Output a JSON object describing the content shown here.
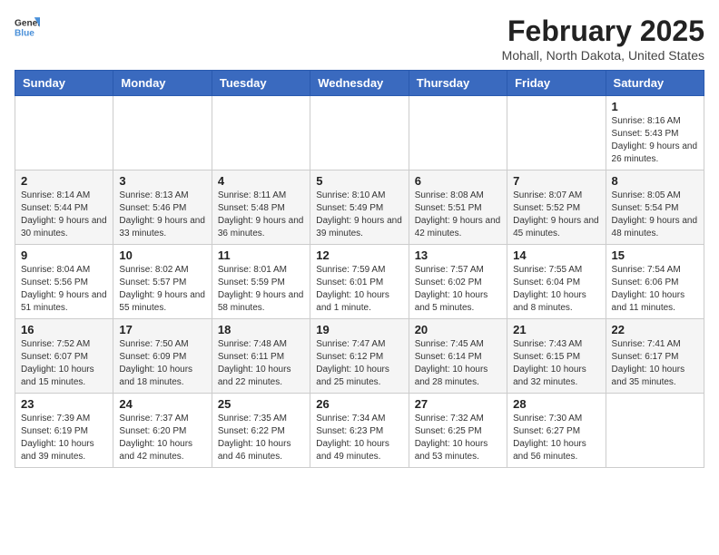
{
  "header": {
    "logo_general": "General",
    "logo_blue": "Blue",
    "title": "February 2025",
    "subtitle": "Mohall, North Dakota, United States"
  },
  "calendar": {
    "days_of_week": [
      "Sunday",
      "Monday",
      "Tuesday",
      "Wednesday",
      "Thursday",
      "Friday",
      "Saturday"
    ],
    "weeks": [
      [
        {
          "day": "",
          "info": ""
        },
        {
          "day": "",
          "info": ""
        },
        {
          "day": "",
          "info": ""
        },
        {
          "day": "",
          "info": ""
        },
        {
          "day": "",
          "info": ""
        },
        {
          "day": "",
          "info": ""
        },
        {
          "day": "1",
          "info": "Sunrise: 8:16 AM\nSunset: 5:43 PM\nDaylight: 9 hours and 26 minutes."
        }
      ],
      [
        {
          "day": "2",
          "info": "Sunrise: 8:14 AM\nSunset: 5:44 PM\nDaylight: 9 hours and 30 minutes."
        },
        {
          "day": "3",
          "info": "Sunrise: 8:13 AM\nSunset: 5:46 PM\nDaylight: 9 hours and 33 minutes."
        },
        {
          "day": "4",
          "info": "Sunrise: 8:11 AM\nSunset: 5:48 PM\nDaylight: 9 hours and 36 minutes."
        },
        {
          "day": "5",
          "info": "Sunrise: 8:10 AM\nSunset: 5:49 PM\nDaylight: 9 hours and 39 minutes."
        },
        {
          "day": "6",
          "info": "Sunrise: 8:08 AM\nSunset: 5:51 PM\nDaylight: 9 hours and 42 minutes."
        },
        {
          "day": "7",
          "info": "Sunrise: 8:07 AM\nSunset: 5:52 PM\nDaylight: 9 hours and 45 minutes."
        },
        {
          "day": "8",
          "info": "Sunrise: 8:05 AM\nSunset: 5:54 PM\nDaylight: 9 hours and 48 minutes."
        }
      ],
      [
        {
          "day": "9",
          "info": "Sunrise: 8:04 AM\nSunset: 5:56 PM\nDaylight: 9 hours and 51 minutes."
        },
        {
          "day": "10",
          "info": "Sunrise: 8:02 AM\nSunset: 5:57 PM\nDaylight: 9 hours and 55 minutes."
        },
        {
          "day": "11",
          "info": "Sunrise: 8:01 AM\nSunset: 5:59 PM\nDaylight: 9 hours and 58 minutes."
        },
        {
          "day": "12",
          "info": "Sunrise: 7:59 AM\nSunset: 6:01 PM\nDaylight: 10 hours and 1 minute."
        },
        {
          "day": "13",
          "info": "Sunrise: 7:57 AM\nSunset: 6:02 PM\nDaylight: 10 hours and 5 minutes."
        },
        {
          "day": "14",
          "info": "Sunrise: 7:55 AM\nSunset: 6:04 PM\nDaylight: 10 hours and 8 minutes."
        },
        {
          "day": "15",
          "info": "Sunrise: 7:54 AM\nSunset: 6:06 PM\nDaylight: 10 hours and 11 minutes."
        }
      ],
      [
        {
          "day": "16",
          "info": "Sunrise: 7:52 AM\nSunset: 6:07 PM\nDaylight: 10 hours and 15 minutes."
        },
        {
          "day": "17",
          "info": "Sunrise: 7:50 AM\nSunset: 6:09 PM\nDaylight: 10 hours and 18 minutes."
        },
        {
          "day": "18",
          "info": "Sunrise: 7:48 AM\nSunset: 6:11 PM\nDaylight: 10 hours and 22 minutes."
        },
        {
          "day": "19",
          "info": "Sunrise: 7:47 AM\nSunset: 6:12 PM\nDaylight: 10 hours and 25 minutes."
        },
        {
          "day": "20",
          "info": "Sunrise: 7:45 AM\nSunset: 6:14 PM\nDaylight: 10 hours and 28 minutes."
        },
        {
          "day": "21",
          "info": "Sunrise: 7:43 AM\nSunset: 6:15 PM\nDaylight: 10 hours and 32 minutes."
        },
        {
          "day": "22",
          "info": "Sunrise: 7:41 AM\nSunset: 6:17 PM\nDaylight: 10 hours and 35 minutes."
        }
      ],
      [
        {
          "day": "23",
          "info": "Sunrise: 7:39 AM\nSunset: 6:19 PM\nDaylight: 10 hours and 39 minutes."
        },
        {
          "day": "24",
          "info": "Sunrise: 7:37 AM\nSunset: 6:20 PM\nDaylight: 10 hours and 42 minutes."
        },
        {
          "day": "25",
          "info": "Sunrise: 7:35 AM\nSunset: 6:22 PM\nDaylight: 10 hours and 46 minutes."
        },
        {
          "day": "26",
          "info": "Sunrise: 7:34 AM\nSunset: 6:23 PM\nDaylight: 10 hours and 49 minutes."
        },
        {
          "day": "27",
          "info": "Sunrise: 7:32 AM\nSunset: 6:25 PM\nDaylight: 10 hours and 53 minutes."
        },
        {
          "day": "28",
          "info": "Sunrise: 7:30 AM\nSunset: 6:27 PM\nDaylight: 10 hours and 56 minutes."
        },
        {
          "day": "",
          "info": ""
        }
      ]
    ]
  }
}
